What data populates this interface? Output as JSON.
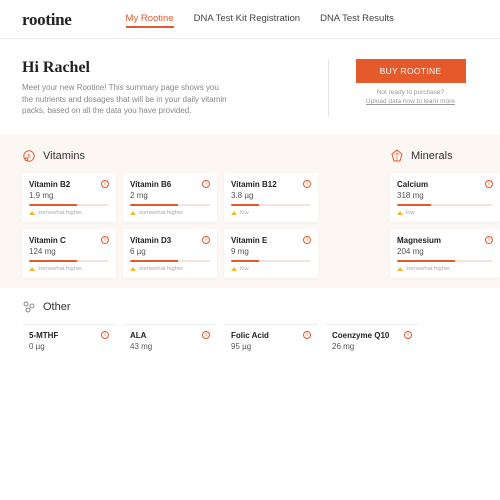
{
  "brand": "rootine",
  "nav": {
    "my": "My Rootine",
    "reg": "DNA Test Kit Registration",
    "res": "DNA Test Results"
  },
  "hero": {
    "greeting": "Hi Rachel",
    "body": "Meet your new Rootine! This summary page shows you the nutrients and dosages that will be in your daily vitamin packs, based on all the data you have provided.",
    "buy": "BUY ROOTINE",
    "sub1": "Not ready to purchase?",
    "sub2": "Upload data now to learn more"
  },
  "sections": {
    "vitamins": "Vitamins",
    "minerals": "Minerals",
    "other": "Other"
  },
  "vit": [
    {
      "n": "Vitamin B2",
      "d": "1.9 mg",
      "p": 60,
      "s": "somewhat higher"
    },
    {
      "n": "Vitamin B6",
      "d": "2 mg",
      "p": 60,
      "s": "somewhat higher"
    },
    {
      "n": "Vitamin B12",
      "d": "3.8 µg",
      "p": 35,
      "s": "low"
    },
    {
      "n": "Vitamin C",
      "d": "124 mg",
      "p": 60,
      "s": "somewhat higher"
    },
    {
      "n": "Vitamin D3",
      "d": "6 µg",
      "p": 60,
      "s": "somewhat higher"
    },
    {
      "n": "Vitamin E",
      "d": "9 mg",
      "p": 35,
      "s": "low"
    }
  ],
  "min": [
    {
      "n": "Calcium",
      "d": "318 mg",
      "p": 35,
      "s": "low"
    },
    {
      "n": "Magnesium",
      "d": "204 mg",
      "p": 60,
      "s": "somewhat higher"
    }
  ],
  "oth": [
    {
      "n": "5-MTHF",
      "d": "0 µg"
    },
    {
      "n": "ALA",
      "d": "43 mg"
    },
    {
      "n": "Folic Acid",
      "d": "95 µg"
    },
    {
      "n": "Coenzyme Q10",
      "d": "26 mg"
    }
  ]
}
